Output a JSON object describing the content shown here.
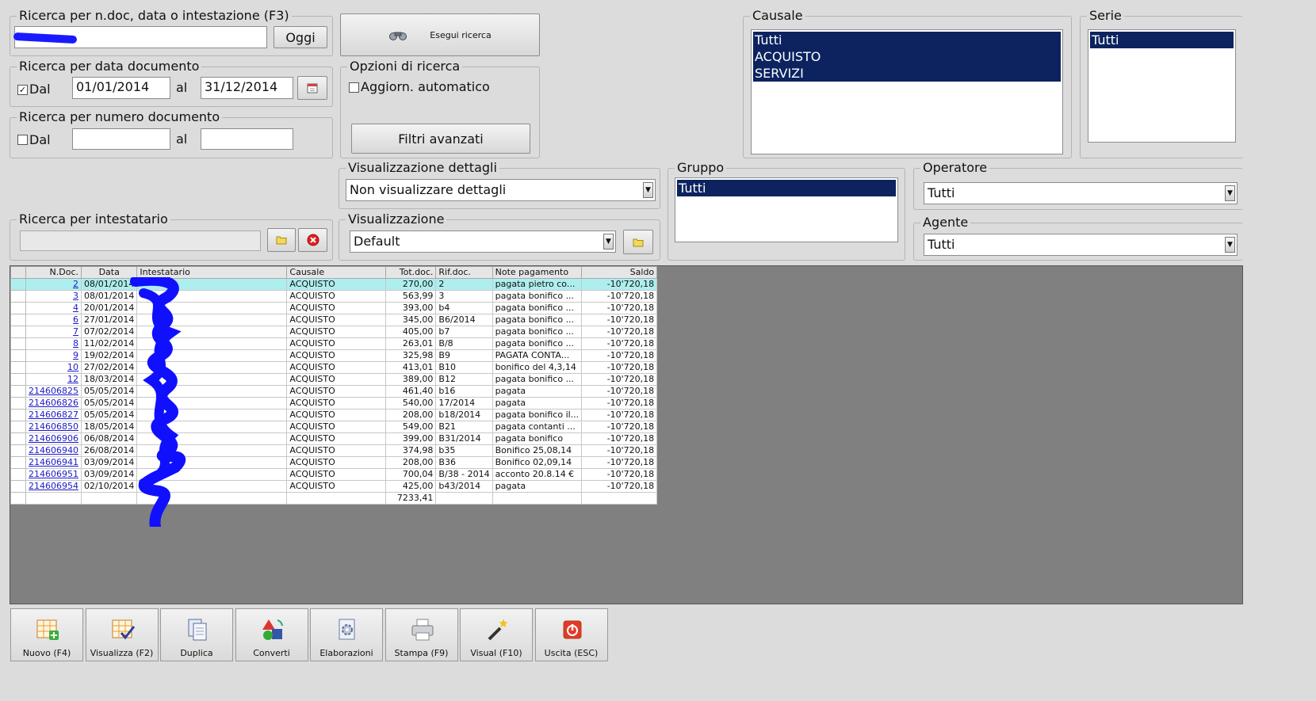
{
  "search_ndoc": {
    "title": "Ricerca per n.doc, data o intestazione (F3)",
    "value": "",
    "today_button": "Oggi"
  },
  "execute_button": "Esegui ricerca",
  "search_date": {
    "title": "Ricerca per data documento",
    "from_label": "Dal",
    "from_checked": true,
    "from_value": "01/01/2014",
    "to_label": "al",
    "to_value": "31/12/2014"
  },
  "search_number": {
    "title": "Ricerca per numero documento",
    "from_label": "Dal",
    "to_label": "al"
  },
  "search_options": {
    "title": "Opzioni di ricerca",
    "auto_update_label": "Aggiorn. automatico",
    "advanced_filters_button": "Filtri avanzati"
  },
  "detail_view": {
    "title": "Visualizzazione dettagli",
    "value": "Non visualizzare dettagli"
  },
  "search_owner": {
    "title": "Ricerca per intestatario"
  },
  "view": {
    "title": "Visualizzazione",
    "value": "Default"
  },
  "causale": {
    "title": "Causale",
    "items": [
      "Tutti",
      "ACQUISTO",
      "SERVIZI"
    ]
  },
  "serie": {
    "title": "Serie",
    "items": [
      "Tutti"
    ]
  },
  "gruppo": {
    "title": "Gruppo",
    "items": [
      "Tutti"
    ]
  },
  "operatore": {
    "title": "Operatore",
    "value": "Tutti"
  },
  "agente": {
    "title": "Agente",
    "value": "Tutti"
  },
  "grid": {
    "columns": [
      "N.Doc.",
      "Data",
      "Intestatario",
      "Causale",
      "Tot.doc.",
      "Rif.doc.",
      "Note pagamento",
      "Saldo"
    ],
    "rows": [
      {
        "ndoc": "2",
        "data": "08/01/2014",
        "causale": "ACQUISTO",
        "tot": "270,00",
        "rif": "2",
        "note": "pagata pietro co...",
        "saldo": "-10'720,18"
      },
      {
        "ndoc": "3",
        "data": "08/01/2014",
        "causale": "ACQUISTO",
        "tot": "563,99",
        "rif": "3",
        "note": "pagata bonifico ...",
        "saldo": "-10'720,18"
      },
      {
        "ndoc": "4",
        "data": "20/01/2014",
        "causale": "ACQUISTO",
        "tot": "393,00",
        "rif": "b4",
        "note": "pagata bonifico ...",
        "saldo": "-10'720,18"
      },
      {
        "ndoc": "6",
        "data": "27/01/2014",
        "causale": "ACQUISTO",
        "tot": "345,00",
        "rif": "B6/2014",
        "note": "pagata bonifico ...",
        "saldo": "-10'720,18"
      },
      {
        "ndoc": "7",
        "data": "07/02/2014",
        "causale": "ACQUISTO",
        "tot": "405,00",
        "rif": "b7",
        "note": "pagata bonifico ...",
        "saldo": "-10'720,18"
      },
      {
        "ndoc": "8",
        "data": "11/02/2014",
        "causale": "ACQUISTO",
        "tot": "263,01",
        "rif": "B/8",
        "note": "pagata bonifico ...",
        "saldo": "-10'720,18"
      },
      {
        "ndoc": "9",
        "data": "19/02/2014",
        "causale": "ACQUISTO",
        "tot": "325,98",
        "rif": "B9",
        "note": "PAGATA CONTA...",
        "saldo": "-10'720,18"
      },
      {
        "ndoc": "10",
        "data": "27/02/2014",
        "causale": "ACQUISTO",
        "tot": "413,01",
        "rif": "B10",
        "note": "bonifico del 4,3,14",
        "saldo": "-10'720,18"
      },
      {
        "ndoc": "12",
        "data": "18/03/2014",
        "causale": "ACQUISTO",
        "tot": "389,00",
        "rif": "B12",
        "note": "pagata bonifico ...",
        "saldo": "-10'720,18"
      },
      {
        "ndoc": "214606825",
        "data": "05/05/2014",
        "causale": "ACQUISTO",
        "tot": "461,40",
        "rif": "b16",
        "note": "pagata",
        "saldo": "-10'720,18"
      },
      {
        "ndoc": "214606826",
        "data": "05/05/2014",
        "causale": "ACQUISTO",
        "tot": "540,00",
        "rif": "17/2014",
        "note": "pagata",
        "saldo": "-10'720,18"
      },
      {
        "ndoc": "214606827",
        "data": "05/05/2014",
        "causale": "ACQUISTO",
        "tot": "208,00",
        "rif": "b18/2014",
        "note": "pagata bonifico il...",
        "saldo": "-10'720,18"
      },
      {
        "ndoc": "214606850",
        "data": "18/05/2014",
        "causale": "ACQUISTO",
        "tot": "549,00",
        "rif": "B21",
        "note": "pagata contanti ...",
        "saldo": "-10'720,18"
      },
      {
        "ndoc": "214606906",
        "data": "06/08/2014",
        "causale": "ACQUISTO",
        "tot": "399,00",
        "rif": "B31/2014",
        "note": "pagata bonifico",
        "saldo": "-10'720,18"
      },
      {
        "ndoc": "214606940",
        "data": "26/08/2014",
        "causale": "ACQUISTO",
        "tot": "374,98",
        "rif": "b35",
        "note": "Bonifico 25,08,14",
        "saldo": "-10'720,18"
      },
      {
        "ndoc": "214606941",
        "data": "03/09/2014",
        "causale": "ACQUISTO",
        "tot": "208,00",
        "rif": "B36",
        "note": "Bonifico 02,09,14",
        "saldo": "-10'720,18"
      },
      {
        "ndoc": "214606951",
        "data": "03/09/2014",
        "causale": "ACQUISTO",
        "tot": "700,04",
        "rif": "B/38 - 2014",
        "note": "acconto 20.8.14 €",
        "saldo": "-10'720,18"
      },
      {
        "ndoc": "214606954",
        "data": "02/10/2014",
        "causale": "ACQUISTO",
        "tot": "425,00",
        "rif": "b43/2014",
        "note": "pagata",
        "saldo": "-10'720,18"
      }
    ],
    "total": "7233,41"
  },
  "toolbar": [
    {
      "name": "new",
      "label": "Nuovo (F4)",
      "icon": "grid-plus-icon"
    },
    {
      "name": "view",
      "label": "Visualizza (F2)",
      "icon": "grid-check-icon"
    },
    {
      "name": "duplicate",
      "label": "Duplica",
      "icon": "copy-icon"
    },
    {
      "name": "convert",
      "label": "Converti",
      "icon": "shapes-icon"
    },
    {
      "name": "process",
      "label": "Elaborazioni",
      "icon": "gear-document-icon"
    },
    {
      "name": "print",
      "label": "Stampa (F9)",
      "icon": "printer-icon"
    },
    {
      "name": "visual",
      "label": "Visual (F10)",
      "icon": "magic-wand-icon"
    },
    {
      "name": "exit",
      "label": "Uscita (ESC)",
      "icon": "power-icon"
    }
  ],
  "colors": {
    "selection": "#0c2360",
    "row_highlight": "#aeeeee",
    "link": "#1a1ac8",
    "grid_bg": "#808080"
  }
}
